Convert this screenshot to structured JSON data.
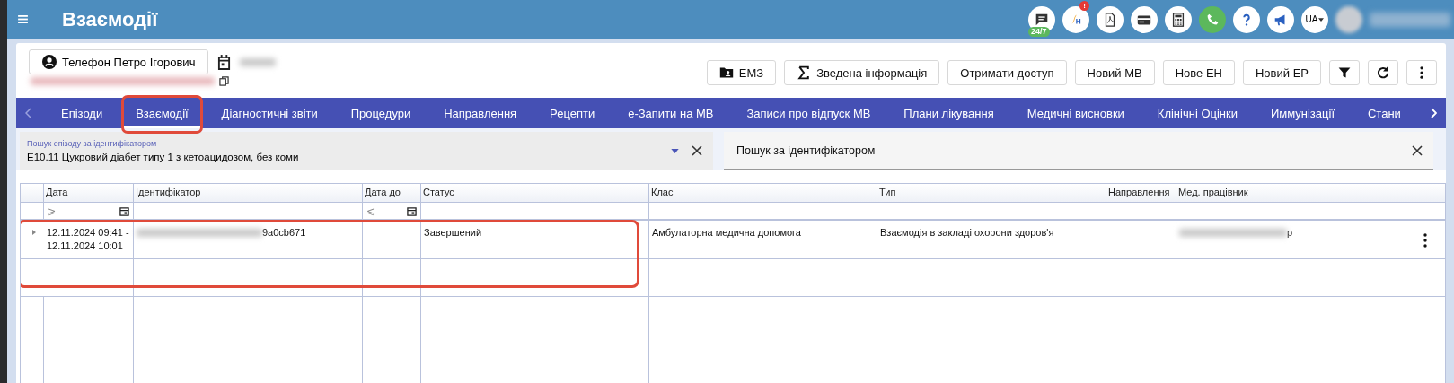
{
  "app_bar": {
    "title": "Взаємодії",
    "chat_badge": "24/7",
    "alert_badge": "!",
    "language": "UA"
  },
  "patient": {
    "name": "Телефон Петро Ігорович"
  },
  "toolbar": {
    "buttons": [
      {
        "kind": "folder",
        "label": "ЕМЗ"
      },
      {
        "kind": "sigma",
        "label": "Зведена інформація"
      },
      {
        "kind": "text",
        "label": "Отримати доступ"
      },
      {
        "kind": "text",
        "label": "Новий МВ"
      },
      {
        "kind": "text",
        "label": "Нове ЕН"
      },
      {
        "kind": "text",
        "label": "Новий ЕР"
      },
      {
        "kind": "filter"
      },
      {
        "kind": "refresh"
      },
      {
        "kind": "more"
      }
    ]
  },
  "tabs": [
    {
      "label": "Епізоди",
      "selected": false,
      "highlighted": false
    },
    {
      "label": "Взаємодії",
      "selected": true,
      "highlighted": true
    },
    {
      "label": "Діагностичні звіти",
      "selected": false,
      "highlighted": false
    },
    {
      "label": "Процедури",
      "selected": false,
      "highlighted": false
    },
    {
      "label": "Направлення",
      "selected": false,
      "highlighted": false
    },
    {
      "label": "Рецепти",
      "selected": false,
      "highlighted": false
    },
    {
      "label": "е-Запити на МВ",
      "selected": false,
      "highlighted": false
    },
    {
      "label": "Записи про відпуск МВ",
      "selected": false,
      "highlighted": false
    },
    {
      "label": "Плани лікування",
      "selected": false,
      "highlighted": false
    },
    {
      "label": "Медичні висновки",
      "selected": false,
      "highlighted": false
    },
    {
      "label": "Клінічні Оцінки",
      "selected": false,
      "highlighted": false
    },
    {
      "label": "Иммунізації",
      "selected": false,
      "highlighted": false
    },
    {
      "label": "Стани",
      "selected": false,
      "highlighted": false
    }
  ],
  "episode_search": {
    "label": "Пошук епізоду за ідентифікатором",
    "value": "E10.11 Цукровий діабет типу 1 з кетоацидозом, без коми"
  },
  "id_search": {
    "placeholder": "Пошук за ідентифікатором"
  },
  "table": {
    "columns": [
      "Дата",
      "Ідентифікатор",
      "Дата до",
      "Статус",
      "Клас",
      "Тип",
      "Направлення",
      "Мед. працівник"
    ],
    "filters": {
      "date_from": "⩾",
      "date_to": "⩽"
    },
    "rows": [
      {
        "date": "12.11.2024 09:41 - 12.11.2024 10:01",
        "identifier": "9a0cb671",
        "status": "Завершений",
        "class": "Амбулаторна медична допомога",
        "type": "Взаємодія в закладі охорони здоров'я",
        "practitioner": "р",
        "highlighted": true
      }
    ]
  }
}
